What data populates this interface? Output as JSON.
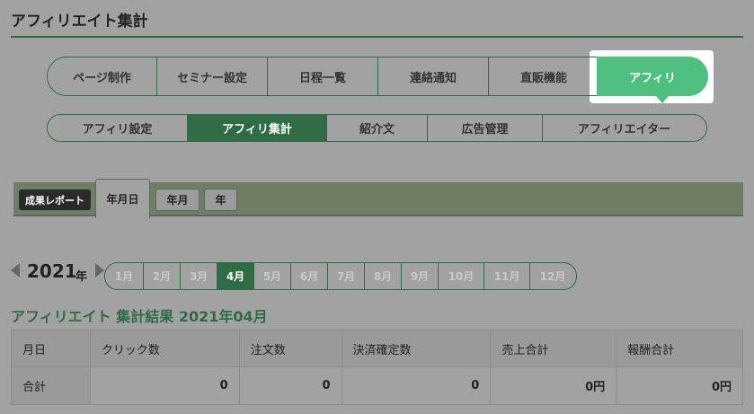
{
  "page": {
    "title": "アフィリエイト集計"
  },
  "main_nav": {
    "items": [
      {
        "label": "ページ制作"
      },
      {
        "label": "セミナー設定"
      },
      {
        "label": "日程一覧"
      },
      {
        "label": "連絡通知"
      },
      {
        "label": "直販機能"
      },
      {
        "label": "アフィリ",
        "active": true
      }
    ]
  },
  "sub_nav": {
    "items": [
      {
        "label": "アフィリ設定"
      },
      {
        "label": "アフィリ集計",
        "active": true
      },
      {
        "label": "紹介文"
      },
      {
        "label": "広告管理"
      },
      {
        "label": "アフィリエイター"
      }
    ]
  },
  "report": {
    "label": "成果レポート",
    "tabs": [
      {
        "label": "年月日",
        "active": true
      },
      {
        "label": "年月"
      },
      {
        "label": "年"
      }
    ]
  },
  "period": {
    "year": "2021",
    "year_suffix": "年",
    "months": [
      "1月",
      "2月",
      "3月",
      "4月",
      "5月",
      "6月",
      "7月",
      "8月",
      "9月",
      "10月",
      "11月",
      "12月"
    ],
    "active_month": "4月"
  },
  "result": {
    "title": "アフィリエイト 集計結果 2021年04月",
    "columns": [
      "月日",
      "クリック数",
      "注文数",
      "決済確定数",
      "売上合計",
      "報酬合計"
    ],
    "rows": [
      {
        "label": "合計",
        "clicks": "0",
        "orders": "0",
        "confirmed": "0",
        "sales": "0円",
        "reward": "0円"
      }
    ]
  },
  "colors": {
    "accent_dark": "#2f6b45",
    "accent_active": "#4fbf7f",
    "overlay_gray": "#a2a2a2"
  }
}
